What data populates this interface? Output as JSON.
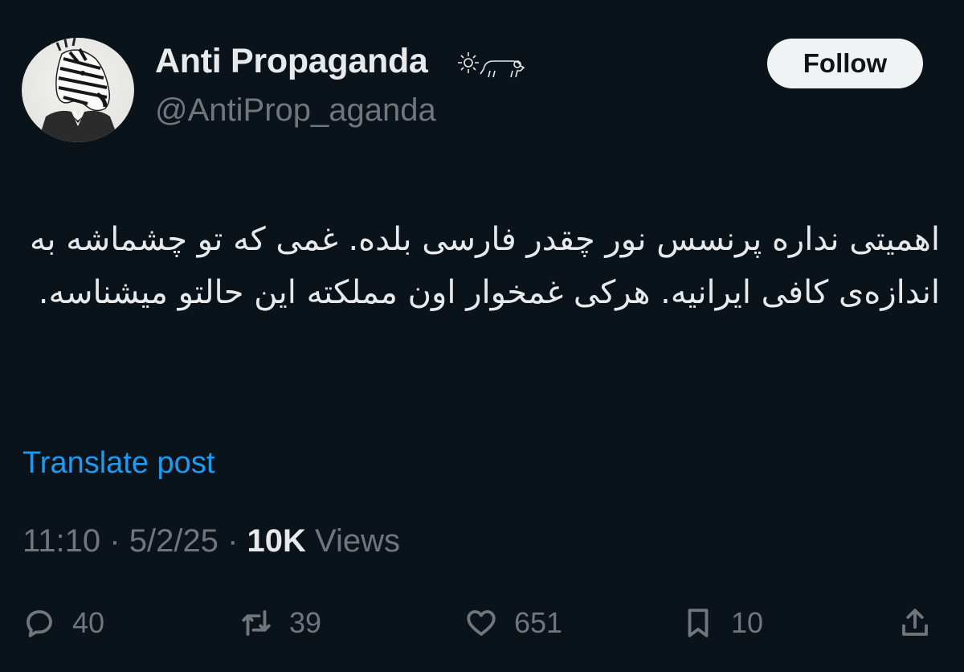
{
  "author": {
    "display_name": "Anti Propaganda",
    "name_emojis": [
      "sun-icon",
      "lion-icon"
    ],
    "handle": "@AntiProp_aganda",
    "avatar": "zebra-in-suit-avatar"
  },
  "follow_label": "Follow",
  "post": {
    "text": "اهمیتی نداره پرنسس نور چقدر فارسی بلده. غمی که تو چشماشه به اندازه‌ی کافی ایرانیه. هرکی غمخوار اون مملکته این حالتو میشناسه."
  },
  "translate_label": "Translate post",
  "meta": {
    "time": "11:10",
    "separator1": "·",
    "date": "5/2/25",
    "separator2": "·",
    "views_count": "10K",
    "views_label": "Views"
  },
  "actions": {
    "replies": "40",
    "reposts": "39",
    "likes": "651",
    "bookmarks": "10"
  },
  "colors": {
    "background": "#0a121a",
    "text": "#e7e9ea",
    "secondary": "#71767b",
    "link": "#1d9bf0",
    "follow_bg": "#eff3f4"
  }
}
